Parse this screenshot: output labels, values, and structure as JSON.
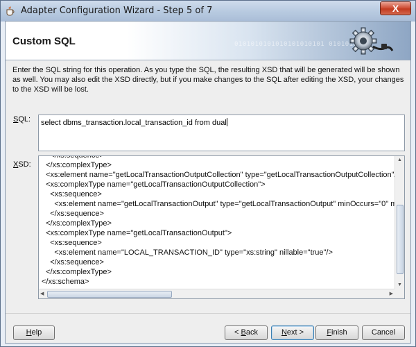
{
  "window": {
    "title": "Adapter Configuration Wizard - Step 5 of 7",
    "close_label": "X"
  },
  "header": {
    "title": "Custom SQL",
    "decor_binary": "0101010101010101010101 01010101"
  },
  "description": "Enter the SQL string for this operation.  As you type the SQL, the resulting XSD that will be generated will be shown as well.  You may also edit the XSD directly, but if you make changes to the SQL after editing the XSD, your changes to the XSD will be lost.",
  "sql": {
    "label_mnemonic": "S",
    "label_rest": "QL:",
    "value": "select dbms_transaction.local_transaction_id from dual"
  },
  "xsd": {
    "label_mnemonic": "X",
    "label_rest": "SD:",
    "lines": [
      "    </xs:sequence>",
      "  </xs:complexType>",
      "  <xs:element name=\"getLocalTransactionOutputCollection\" type=\"getLocalTransactionOutputCollection\"/>",
      "  <xs:complexType name=\"getLocalTransactionOutputCollection\">",
      "    <xs:sequence>",
      "      <xs:element name=\"getLocalTransactionOutput\" type=\"getLocalTransactionOutput\" minOccurs=\"0\" maxOccurs=\"unbounded\"/>",
      "    </xs:sequence>",
      "  </xs:complexType>",
      "  <xs:complexType name=\"getLocalTransactionOutput\">",
      "    <xs:sequence>",
      "      <xs:element name=\"LOCAL_TRANSACTION_ID\" type=\"xs:string\" nillable=\"true\"/>",
      "    </xs:sequence>",
      "  </xs:complexType>",
      "</xs:schema>"
    ]
  },
  "buttons": {
    "help_mnemonic": "H",
    "help_rest": "elp",
    "back_prefix": "< ",
    "back_mnemonic": "B",
    "back_rest": "ack",
    "next_mnemonic": "N",
    "next_rest": "ext >",
    "finish_mnemonic": "F",
    "finish_rest": "inish",
    "cancel": "Cancel"
  }
}
